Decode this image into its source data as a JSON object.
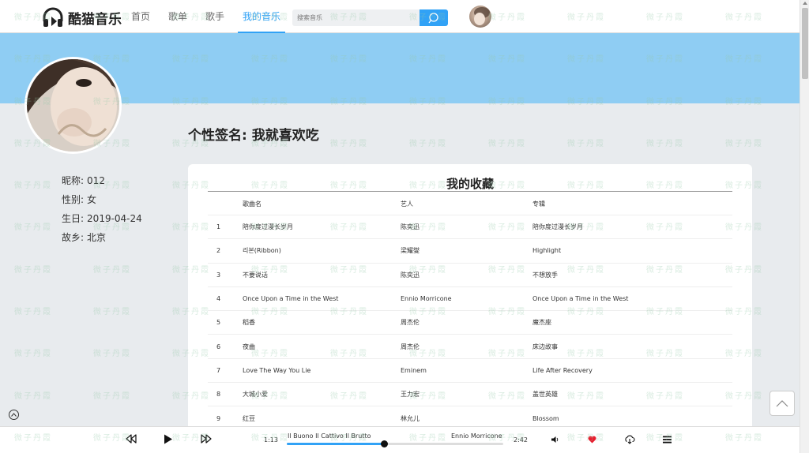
{
  "header": {
    "logo_text": "酷猫音乐",
    "nav": [
      {
        "label": "首页",
        "active": false
      },
      {
        "label": "歌单",
        "active": false
      },
      {
        "label": "歌手",
        "active": false
      },
      {
        "label": "我的音乐",
        "active": true
      }
    ],
    "search_placeholder": "搜索音乐",
    "accent_color": "#31a2f6"
  },
  "profile": {
    "signature": "个性签名: 我就喜欢吃",
    "info": [
      {
        "label": "昵称:",
        "value": "012"
      },
      {
        "label": "性别:",
        "value": "女"
      },
      {
        "label": "生日:",
        "value": "2019-04-24"
      },
      {
        "label": "故乡:",
        "value": "北京"
      }
    ]
  },
  "favorites": {
    "title": "我的收藏",
    "columns": [
      "歌曲名",
      "艺人",
      "专辑"
    ],
    "rows": [
      {
        "idx": "1",
        "name": "陪你度过漫长岁月",
        "artist": "陈奕迅",
        "album": "陪你度过漫长岁月"
      },
      {
        "idx": "2",
        "name": "리본(Ribbon)",
        "artist": "梁耀燮",
        "album": "Highlight"
      },
      {
        "idx": "3",
        "name": "不要说话",
        "artist": "陈奕迅",
        "album": "不想放手"
      },
      {
        "idx": "4",
        "name": "Once Upon a Time in the West",
        "artist": "Ennio Morricone",
        "album": "Once Upon a Time in the West"
      },
      {
        "idx": "5",
        "name": "稻香",
        "artist": "周杰伦",
        "album": "魔杰座"
      },
      {
        "idx": "6",
        "name": "夜曲",
        "artist": "周杰伦",
        "album": "床边故事"
      },
      {
        "idx": "7",
        "name": "Love The Way You Lie",
        "artist": "Eminem",
        "album": "Life After Recovery"
      },
      {
        "idx": "8",
        "name": "大城小爱",
        "artist": "王力宏",
        "album": "盖世英雄"
      },
      {
        "idx": "9",
        "name": "红豆",
        "artist": "林允儿",
        "album": "Blossom"
      }
    ]
  },
  "player": {
    "current_time": "1:13",
    "total_time": "2:42",
    "track_title": "Il Buono Il Cattivo Il Brutto",
    "track_artist": "Ennio Morricone",
    "progress_fraction": 0.45,
    "liked": true
  },
  "watermark_text": "微子丹霞"
}
